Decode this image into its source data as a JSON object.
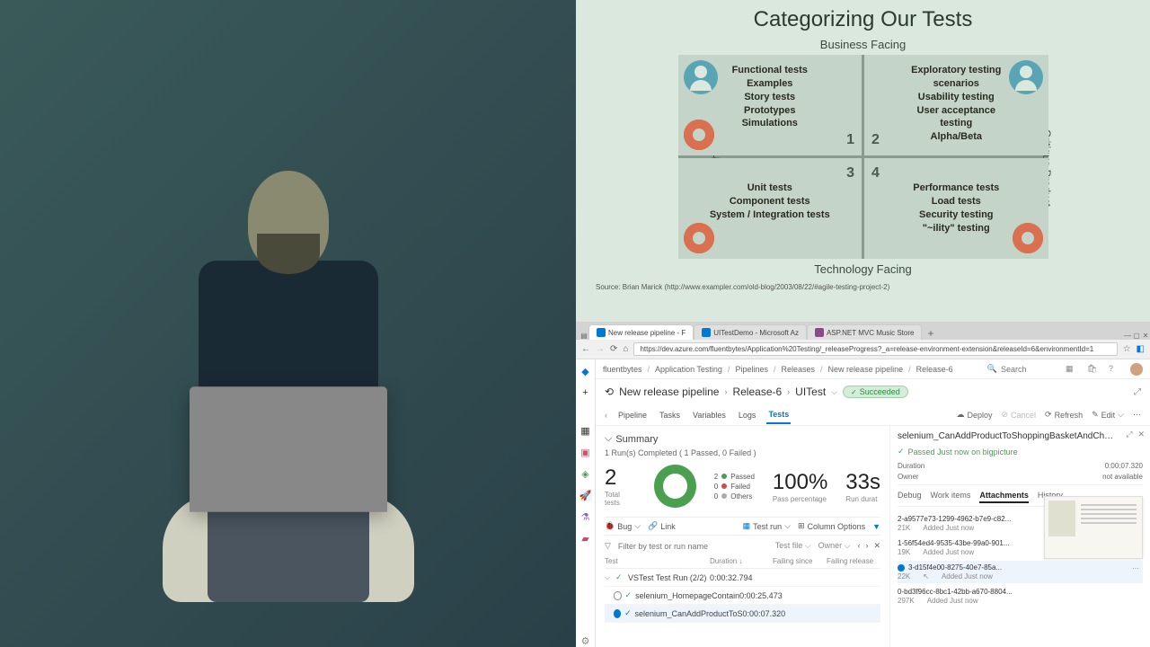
{
  "diagram": {
    "title": "Categorizing Our Tests",
    "axis_top": "Business Facing",
    "axis_bottom": "Technology Facing",
    "axis_left": "Supporting the Team",
    "axis_right": "Critique Product",
    "q1": {
      "num": "1",
      "lines": [
        "Functional tests",
        "Examples",
        "Story tests",
        "Prototypes",
        "Simulations"
      ]
    },
    "q2": {
      "num": "2",
      "lines": [
        "Exploratory testing",
        "scenarios",
        "Usability testing",
        "User acceptance",
        "testing",
        "Alpha/Beta"
      ]
    },
    "q3": {
      "num": "3",
      "lines": [
        "Unit tests",
        "Component tests",
        "System / Integration tests"
      ]
    },
    "q4": {
      "num": "4",
      "lines": [
        "Performance tests",
        "Load tests",
        "Security testing",
        "\"~ility\" testing"
      ]
    },
    "source": "Source: Brian Marick (http://www.exampler.com/old-blog/2003/08/22/#agile-testing-project-2)"
  },
  "browser": {
    "tabs": [
      {
        "label": "New release pipeline - F",
        "active": true
      },
      {
        "label": "UITestDemo - Microsoft Az",
        "active": false
      },
      {
        "label": "ASP.NET MVC Music Store",
        "active": false
      }
    ],
    "url": "https://dev.azure.com/fluentbytes/Application%20Testing/_releaseProgress?_a=release-environment-extension&releaseId=6&environmentId=1"
  },
  "breadcrumb": [
    "fluentbytes",
    "Application Testing",
    "Pipelines",
    "Releases",
    "New release pipeline",
    "Release-6"
  ],
  "search_placeholder": "Search",
  "title": {
    "a": "New release pipeline",
    "b": "Release-6",
    "c": "UITest",
    "badge": "Succeeded"
  },
  "cmd_tabs": [
    "Pipeline",
    "Tasks",
    "Variables",
    "Logs",
    "Tests"
  ],
  "cmd_active": "Tests",
  "actions": {
    "deploy": "Deploy",
    "cancel": "Cancel",
    "refresh": "Refresh",
    "edit": "Edit"
  },
  "summary": {
    "header": "Summary",
    "sub": "1 Run(s) Completed ( 1 Passed, 0 Failed )",
    "total": {
      "n": "2",
      "lbl": "Total tests"
    },
    "legend": [
      {
        "n": "2",
        "lbl": "Passed",
        "c": "green"
      },
      {
        "n": "0",
        "lbl": "Failed",
        "c": "red"
      },
      {
        "n": "0",
        "lbl": "Others",
        "c": "gray"
      }
    ],
    "pct": {
      "n": "100%",
      "lbl": "Pass percentage"
    },
    "dur": {
      "n": "33s",
      "lbl": "Run durat"
    }
  },
  "toolbar": {
    "bug": "Bug",
    "link": "Link",
    "testrun": "Test run",
    "cols": "Column Options"
  },
  "filter": {
    "placeholder": "Filter by test or run name",
    "group": "Test file",
    "owner": "Owner"
  },
  "thead": {
    "test": "Test",
    "dur": "Duration",
    "fs": "Failing since",
    "fr": "Failing release"
  },
  "rows": [
    {
      "name": "VSTest Test Run (2/2)",
      "dur": "0:00:32.794",
      "group": true
    },
    {
      "name": "selenium_HomepageContain",
      "dur": "0:00:25.473"
    },
    {
      "name": "selenium_CanAddProductToS",
      "dur": "0:00:07.320",
      "sel": true
    }
  ],
  "detail": {
    "title": "selenium_CanAddProductToShoppingBasketAndCheckOutSelenium",
    "status": "Passed Just now on bigpicture",
    "duration_lbl": "Duration",
    "duration": "0:00:07.320",
    "owner_lbl": "Owner",
    "owner": "not available",
    "tabs": [
      "Debug",
      "Work items",
      "Attachments",
      "History"
    ],
    "active_tab": "Attachments",
    "attachments": [
      {
        "fn": "2-a9577e73-1299-4962-b7e9-c82...",
        "size": "21K",
        "added": "Added Just now"
      },
      {
        "fn": "1-56f54ed4-9535-43be-99a0-901...",
        "size": "19K",
        "added": "Added Just now"
      },
      {
        "fn": "3-d15f4e00-8275-40e7-85a...",
        "size": "22K",
        "added": "Added Just now",
        "sel": true
      },
      {
        "fn": "0-bd3f96cc-8bc1-42bb-a670-8804...",
        "size": "297K",
        "added": "Added Just now"
      }
    ]
  }
}
